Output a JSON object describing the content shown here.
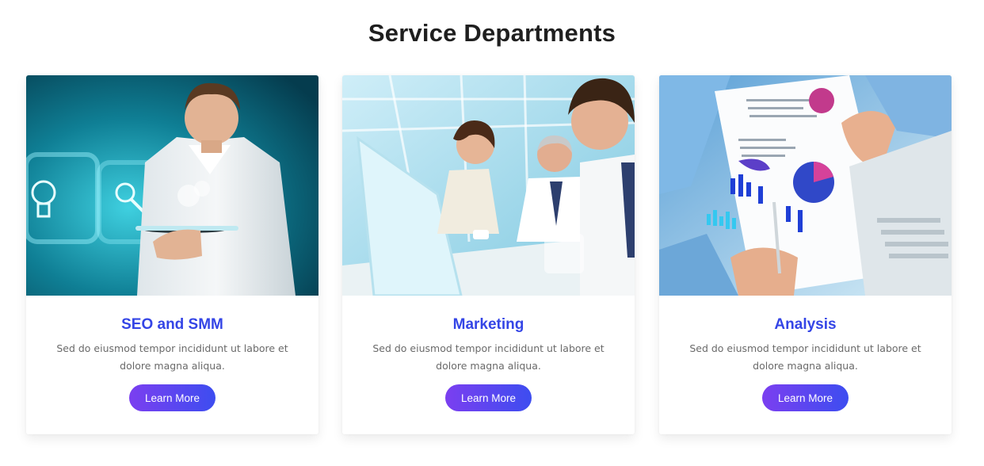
{
  "section": {
    "title": "Service Departments"
  },
  "colors": {
    "title_accent": "#3445e6",
    "button_gradient_start": "#7b3ff0",
    "button_gradient_end": "#3d4df0"
  },
  "cards": [
    {
      "image": "man-holding-tablet-with-icons-photo",
      "title": "SEO and SMM",
      "text": "Sed do eiusmod tempor incididunt ut labore et dolore magna aliqua.",
      "button": "Learn More"
    },
    {
      "image": "business-team-meeting-at-laptop-photo",
      "title": "Marketing",
      "text": "Sed do eiusmod tempor incididunt ut labore et dolore magna aliqua.",
      "button": "Learn More"
    },
    {
      "image": "hands-reviewing-charts-over-laptop-photo",
      "title": "Analysis",
      "text": "Sed do eiusmod tempor incididunt ut labore et dolore magna aliqua.",
      "button": "Learn More"
    }
  ]
}
